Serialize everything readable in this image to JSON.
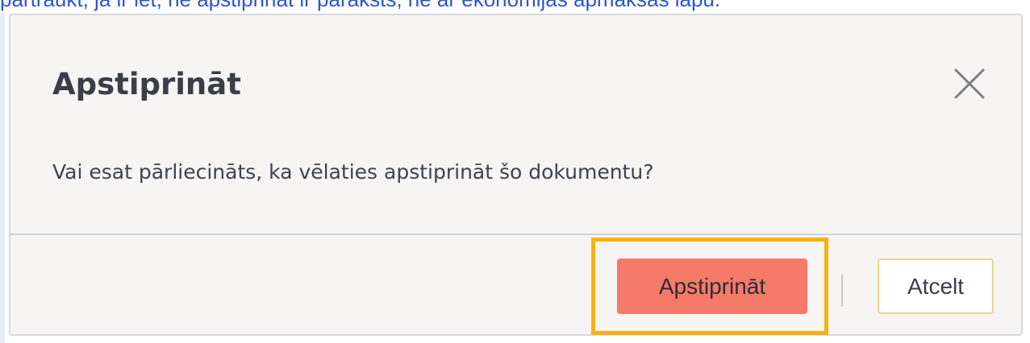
{
  "background": {
    "page_text": "pārtraukt, ja ir iet, ne apstiprināt ir paraksts, ne ar ekonomijas apmaksas lapu.",
    "link_color": "#2f55d4"
  },
  "dialog": {
    "title": "Apstiprināt",
    "message": "Vai esat pārliecināts, ka vēlaties apstiprināt šo dokumentu?",
    "close_icon": "close-icon",
    "confirm_label": "Apstiprināt",
    "cancel_label": "Atcelt",
    "separator_text": "|"
  },
  "colors": {
    "confirm_button": "#f67a68",
    "highlight_frame": "#f8b10e",
    "dialog_background": "#f6f5f3"
  }
}
